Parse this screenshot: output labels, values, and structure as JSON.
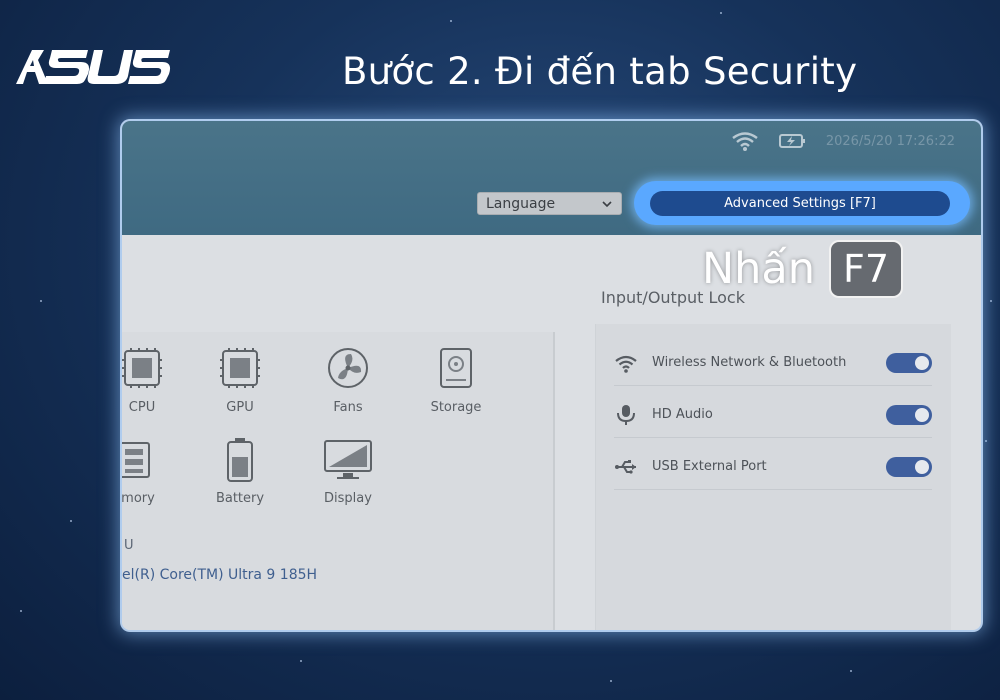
{
  "brand": {
    "name": "ASUS"
  },
  "step_title": "Bước 2. Đi đến tab Security",
  "bios": {
    "status": {
      "datetime": "2026/5/20 17:26:22",
      "icons": [
        "wifi-icon",
        "battery-charging-icon"
      ]
    },
    "language_select": {
      "value": "Language"
    },
    "advanced_button": {
      "label": "Advanced Settings [F7]"
    },
    "press_hint": {
      "label": "Nhấn",
      "key": "F7"
    },
    "devices": [
      {
        "label": "CPU",
        "icon": "cpu-icon"
      },
      {
        "label": "GPU",
        "icon": "gpu-icon"
      },
      {
        "label": "Fans",
        "icon": "fan-icon"
      },
      {
        "label": "Storage",
        "icon": "storage-icon"
      },
      {
        "label": "emory",
        "icon": "memory-icon"
      },
      {
        "label": "Battery",
        "icon": "battery-icon"
      },
      {
        "label": "Display",
        "icon": "display-icon"
      }
    ],
    "cpu_info": {
      "name": "U",
      "value": "el(R) Core(TM) Ultra 9 185H"
    },
    "io_lock": {
      "title": "Input/Output Lock",
      "items": [
        {
          "label": "Wireless Network & Bluetooth",
          "icon": "wifi-icon",
          "enabled": true
        },
        {
          "label": "HD Audio",
          "icon": "microphone-icon",
          "enabled": true
        },
        {
          "label": "USB External Port",
          "icon": "usb-icon",
          "enabled": true
        }
      ]
    }
  },
  "colors": {
    "accent": "#5aa8ff",
    "button": "#1e4b8f",
    "toggle_on": "#3f5f9e",
    "header": "#4a7489"
  }
}
